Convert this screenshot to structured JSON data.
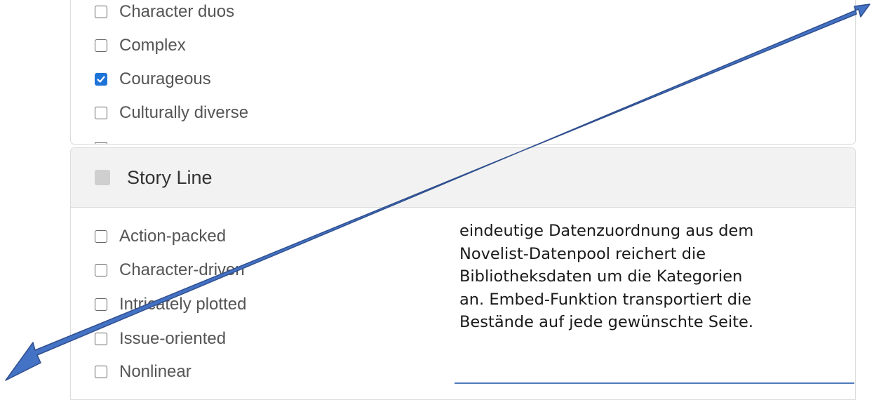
{
  "colors": {
    "arrow": "#4472c4",
    "arrow_outline": "#2f4f8f",
    "checkbox_checked": "#1e73d8",
    "header_bg": "#f2f2f2"
  },
  "top_group": {
    "options": [
      {
        "label": "Character duos",
        "checked": false
      },
      {
        "label": "Complex",
        "checked": false
      },
      {
        "label": "Courageous",
        "checked": true
      },
      {
        "label": "Culturally diverse",
        "checked": false
      }
    ]
  },
  "story_line": {
    "title": "Story Line",
    "options": [
      {
        "label": "Action-packed",
        "checked": false
      },
      {
        "label": "Character-driven",
        "checked": false
      },
      {
        "label": "Intricately plotted",
        "checked": false
      },
      {
        "label": "Issue-oriented",
        "checked": false
      },
      {
        "label": "Nonlinear",
        "checked": false
      }
    ]
  },
  "caption": {
    "lines": [
      "eindeutige Datenzuordnung aus dem",
      "Novelist-Datenpool reichert die",
      "Bibliotheksdaten um die Kategorien",
      "an. Embed-Funktion transportiert die",
      "Bestände auf jede gewünschte Seite."
    ]
  },
  "annotation": {
    "shape": "double-headed-arrow"
  }
}
